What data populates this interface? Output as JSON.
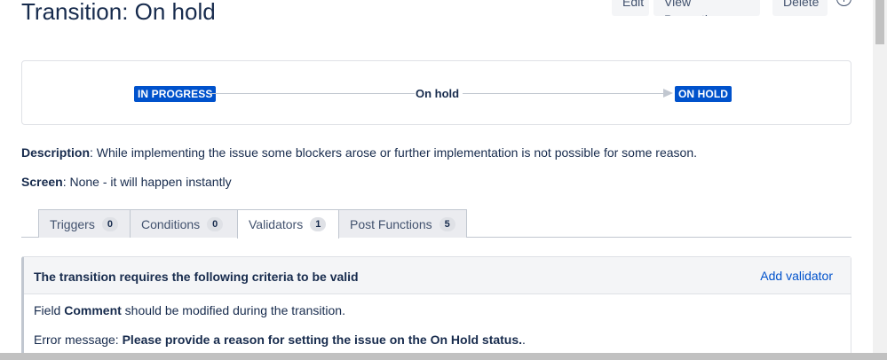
{
  "header": {
    "title": "Transition: On hold",
    "buttons": {
      "edit": "Edit",
      "view_properties": "View Properties",
      "delete": "Delete"
    }
  },
  "diagram": {
    "from_status": "IN PROGRESS",
    "transition": "On hold",
    "to_status": "ON HOLD"
  },
  "details": {
    "description_label": "Description",
    "description_text": ": While implementing the issue some blockers arose or further implementation is not possible for some reason.",
    "screen_label": "Screen",
    "screen_text": ": None - it will happen instantly"
  },
  "tabs": [
    {
      "label": "Triggers",
      "count": "0"
    },
    {
      "label": "Conditions",
      "count": "0"
    },
    {
      "label": "Validators",
      "count": "1"
    },
    {
      "label": "Post Functions",
      "count": "5"
    }
  ],
  "validators_panel": {
    "heading": "The transition requires the following criteria to be valid",
    "add_link": "Add validator",
    "field_prefix": "Field ",
    "field_name": "Comment",
    "field_suffix": " should be modified during the transition.",
    "error_prefix": "Error message: ",
    "error_message": "Please provide a reason for setting the issue on the On Hold status.",
    "error_suffix": "."
  },
  "colors": {
    "status_blue": "#0052cc",
    "text_dark": "#172b4d",
    "link_blue": "#0052cc",
    "tab_bg": "#ebecf0"
  }
}
